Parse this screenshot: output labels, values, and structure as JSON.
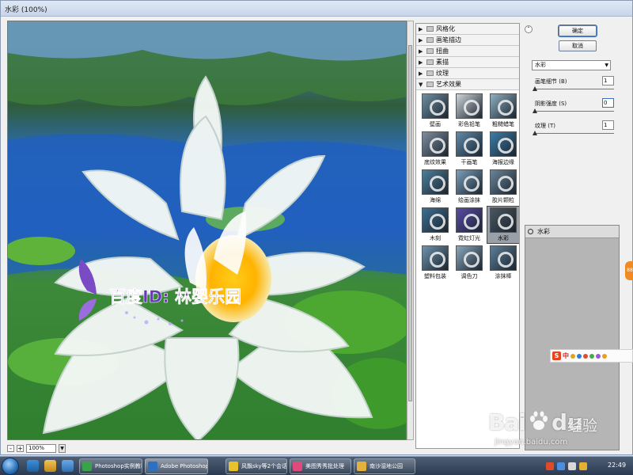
{
  "window": {
    "title": "水彩 (100%)"
  },
  "preview": {
    "watermark_text": "百度ID: 林婴乐园",
    "zoom": "100%",
    "zoom_minus": "-",
    "zoom_plus": "+"
  },
  "filter_tree": {
    "categories_collapsed": [
      {
        "label": "风格化"
      },
      {
        "label": "画笔描边"
      },
      {
        "label": "扭曲"
      },
      {
        "label": "素描"
      },
      {
        "label": "纹理"
      }
    ],
    "expanded_category": {
      "label": "艺术效果"
    },
    "filters": [
      {
        "label": "壁画",
        "color": "#6f8fa3"
      },
      {
        "label": "彩色铅笔",
        "color": "#cfd6dc"
      },
      {
        "label": "粗糙蜡笔",
        "color": "#8fb0c2"
      },
      {
        "label": "底纹效果",
        "color": "#7f8ea0"
      },
      {
        "label": "干画笔",
        "color": "#5f8cab"
      },
      {
        "label": "海报边缘",
        "color": "#3d7da8"
      },
      {
        "label": "海绵",
        "color": "#4d7f9c"
      },
      {
        "label": "绘画涂抹",
        "color": "#7aa0bb"
      },
      {
        "label": "胶片颗粒",
        "color": "#6b8599"
      },
      {
        "label": "木刻",
        "color": "#3e6f92"
      },
      {
        "label": "霓虹灯光",
        "color": "#5a4ba8"
      },
      {
        "label": "水彩",
        "color": "#4a5660",
        "selected": true
      },
      {
        "label": "塑料包装",
        "color": "#6f93ad"
      },
      {
        "label": "调色刀",
        "color": "#8aa8bd"
      },
      {
        "label": "涂抹棒",
        "color": "#5d7f98"
      }
    ]
  },
  "actions": {
    "ok": "确定",
    "cancel": "取消",
    "collapse": "⌃"
  },
  "settings": {
    "filter_select": "水彩",
    "params": [
      {
        "label": "画笔细节 (B)",
        "value": "1",
        "level": 0.0
      },
      {
        "label": "阴影强度 (S)",
        "value": "0",
        "level": 0.0
      },
      {
        "label": "纹理 (T)",
        "value": "1",
        "level": 0.0
      }
    ]
  },
  "layers": {
    "items": [
      {
        "label": "水彩"
      }
    ]
  },
  "ime_toolbar": {
    "s": "S",
    "lang": "中"
  },
  "side_tab": {
    "label": "88"
  },
  "site_watermark": {
    "brand_left": "Bai",
    "brand_right": "du",
    "brand_cn": "经验",
    "url": "jingyan.baidu.com"
  },
  "taskbar": {
    "tasks": [
      {
        "label": "Photoshop实例教程...",
        "color": "#3aa24a"
      },
      {
        "label": "Adobe Photoshop ...",
        "color": "#2e6fc0"
      },
      {
        "label": "风飘sky等2个会话",
        "color": "#e8c12c"
      },
      {
        "label": "美图秀秀批处理",
        "color": "#e04a7a"
      },
      {
        "label": "南沙湿地公园",
        "color": "#e3b23c"
      }
    ],
    "clock": "22:49"
  },
  "colors": {
    "accent": "#3a70c6",
    "dialog_bg": "#f0f0f0"
  }
}
